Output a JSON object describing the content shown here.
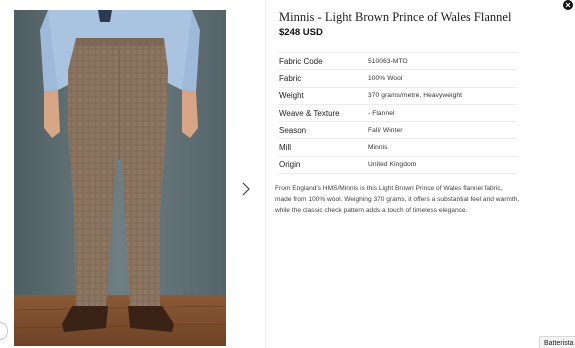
{
  "product": {
    "title": "Minnis - Light Brown Prince of Wales Flannel",
    "price": "$248 USD",
    "image_icon": "trouser-photo"
  },
  "specs": [
    {
      "label": "Fabric Code",
      "value": "510063-MTO"
    },
    {
      "label": "Fabric",
      "value": "100% Wool"
    },
    {
      "label": "Weight",
      "value": "370 grams/metre, Heavyweight"
    },
    {
      "label": "Weave & Texture",
      "value": "- Flannel"
    },
    {
      "label": "Season",
      "value": "Fall/ Winter"
    },
    {
      "label": "Mill",
      "value": "Minnis"
    },
    {
      "label": "Origin",
      "value": "United Kingdom"
    }
  ],
  "description": "From England's HMS/Minnis is this Light Brown Prince of Wales flannel fabric, made from 100% wool. Weighing 370 grams, it offers a substantial feel and warmth, while the classic check pattern adds a touch of timeless elegance.",
  "controls": {
    "next_icon": "chevron-right-icon",
    "close_icon": "close-icon"
  },
  "chat": {
    "label": "Batterista"
  }
}
